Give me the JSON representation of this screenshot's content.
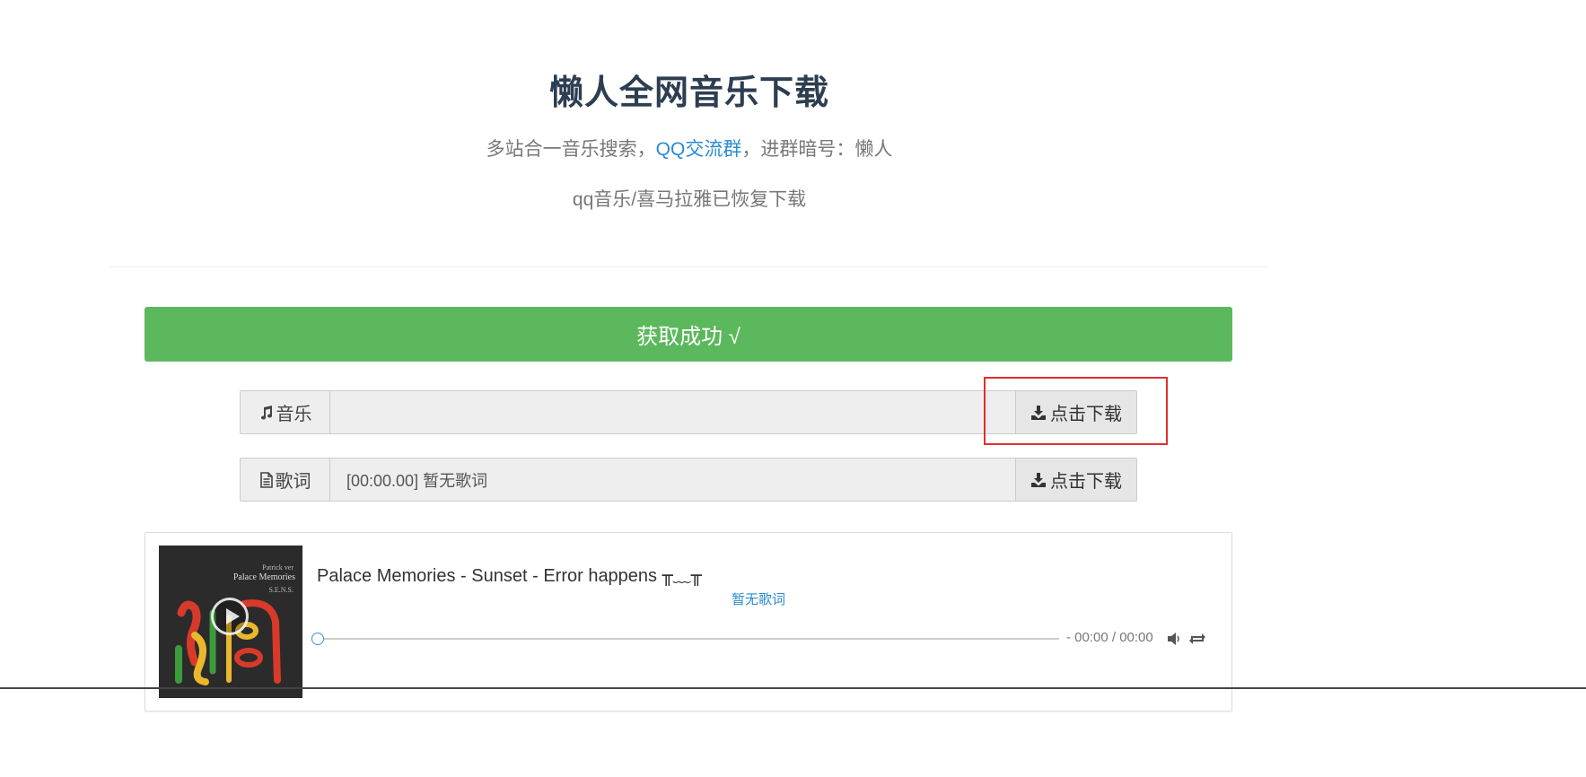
{
  "header": {
    "title": "懒人全网音乐下载",
    "subtitle_prefix": "多站合一音乐搜索，",
    "subtitle_link": "QQ交流群",
    "subtitle_suffix": "，进群暗号：懒人",
    "notice": "qq音乐/喜马拉雅已恢复下载"
  },
  "status": {
    "message": "获取成功 √",
    "color": "#5cb85c"
  },
  "rows": [
    {
      "icon": "music-note-icon",
      "label": "音乐",
      "value": "",
      "button": "点击下载"
    },
    {
      "icon": "document-icon",
      "label": "歌词",
      "value": "[00:00.00] 暂无歌词",
      "button": "点击下载"
    }
  ],
  "player": {
    "cover": {
      "line1": "Patrick ver",
      "line2": "Palace Memories",
      "line3": "S.E.N.S."
    },
    "title": "Palace Memories - Sunset - Error happens ",
    "kaomoji": "╥﹏╥",
    "lyric": "暂无歌词",
    "progress": 0,
    "time": "- 00:00 / 00:00"
  },
  "colors": {
    "accent_link": "#2a8bd0",
    "highlight_border": "#e03030"
  }
}
